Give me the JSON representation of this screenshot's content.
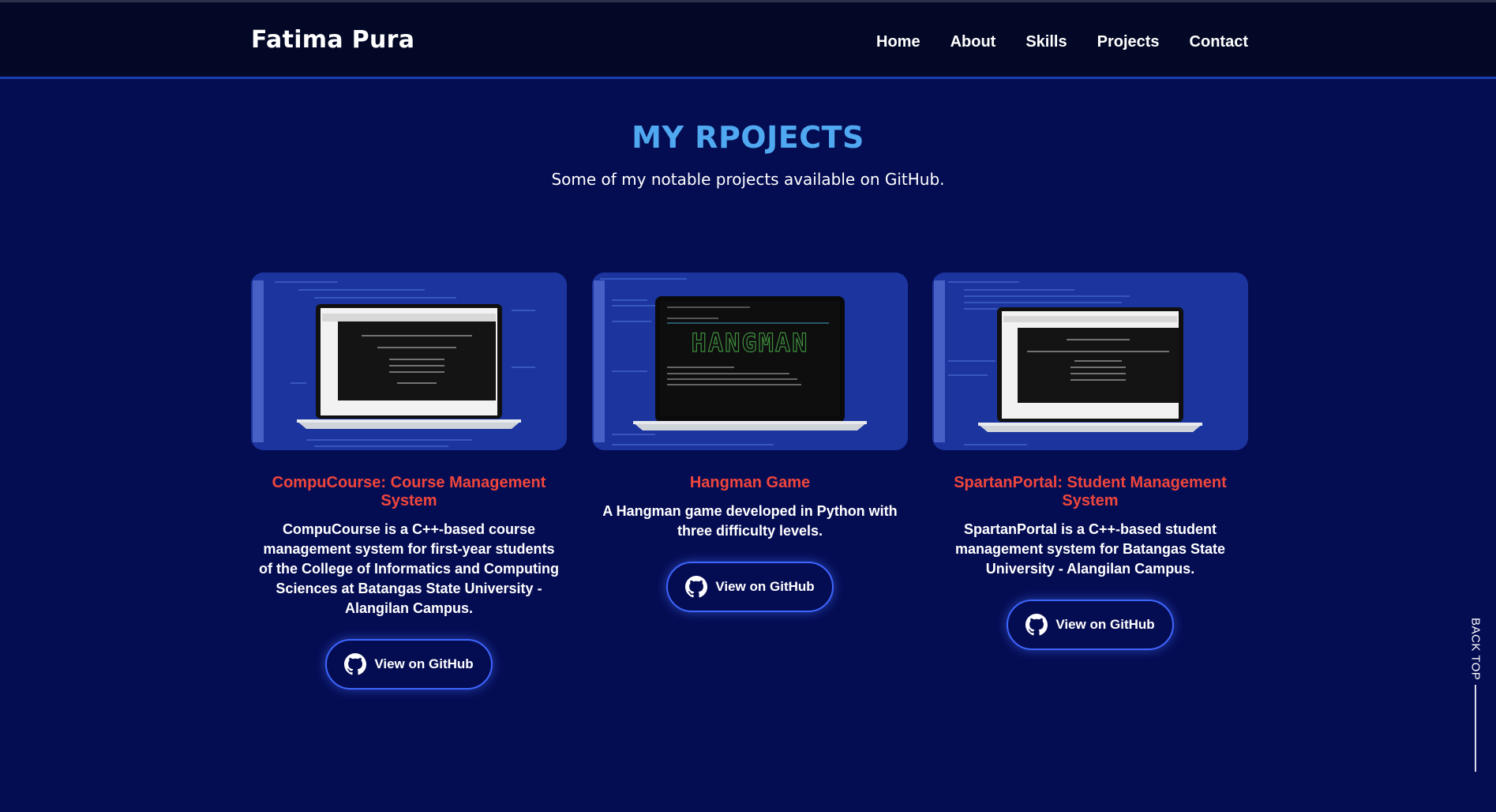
{
  "header": {
    "brand": "Fatima Pura",
    "nav": [
      "Home",
      "About",
      "Skills",
      "Projects",
      "Contact"
    ]
  },
  "projects_section": {
    "title": "MY RPOJECTS",
    "subtitle": "Some of my notable projects available on GitHub."
  },
  "projects": [
    {
      "title": "CompuCourse: Course Management System",
      "description": "CompuCourse is a C++-based course management system for first-year students of the College of Informatics and Computing Sciences at Batangas State University - Alangilan Campus.",
      "button_label": "View on GitHub"
    },
    {
      "title": "Hangman Game",
      "description": "A Hangman game developed in Python with three difficulty levels.",
      "button_label": "View on GitHub",
      "screen_text": "HANGMAN"
    },
    {
      "title": "SpartanPortal: Student Management System",
      "description": "SpartanPortal is a C++-based student management system for Batangas State University - Alangilan Campus.",
      "button_label": "View on GitHub"
    }
  ],
  "back_top": "BACK TOP",
  "colors": {
    "background": "#050d52",
    "header": "#030826",
    "title_blue": "#4fa8f0",
    "project_title_red": "#f0463c",
    "button_border": "#3e66ff"
  }
}
